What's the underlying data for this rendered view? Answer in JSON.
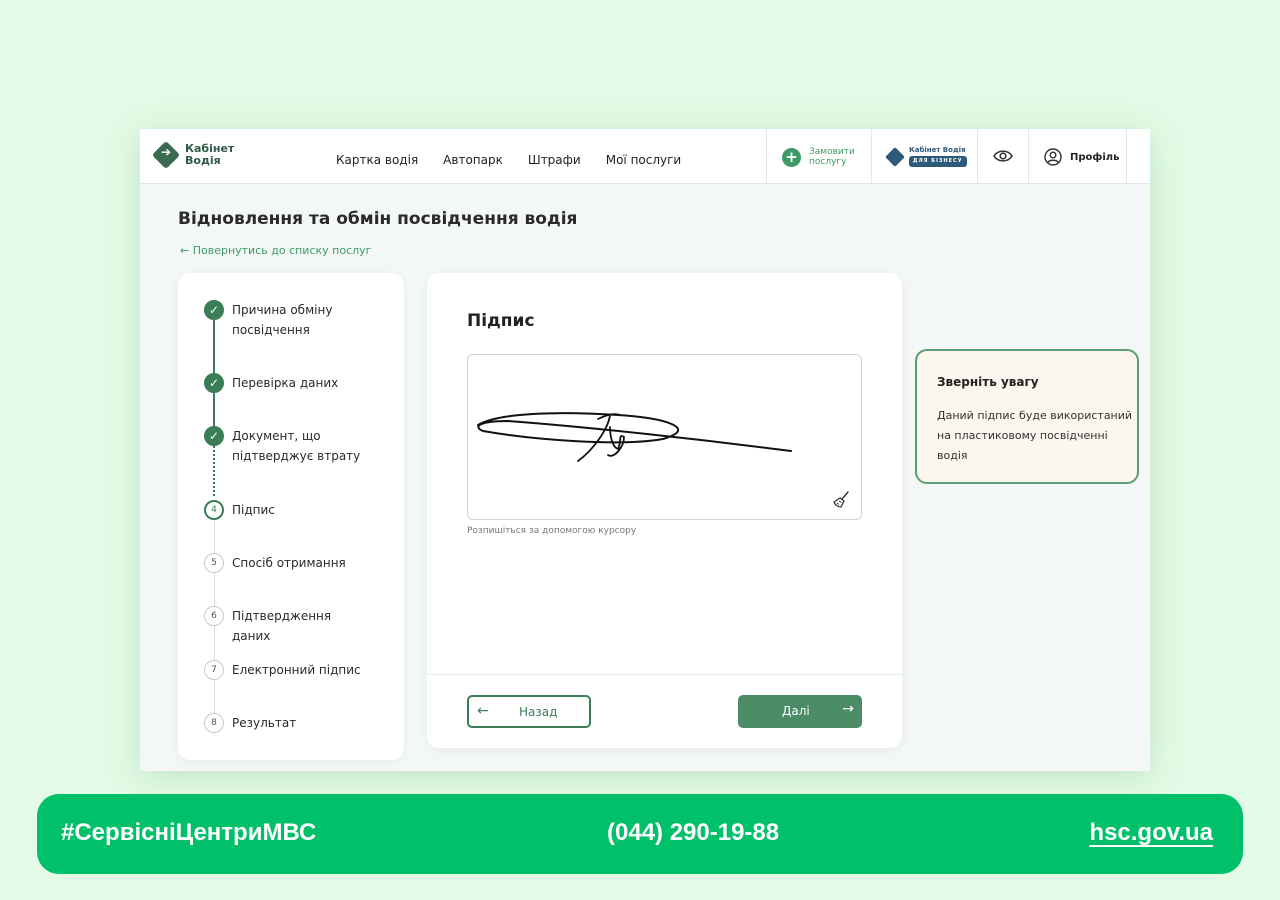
{
  "header": {
    "logo": {
      "line1": "Кабінет",
      "line2": "Водія"
    },
    "nav": [
      "Картка водія",
      "Автопарк",
      "Штрафи",
      "Мої послуги"
    ],
    "order_button": "Замовити послугу",
    "business": {
      "line1": "Кабінет Водія",
      "line2": "ДЛЯ БІЗНЕСУ"
    },
    "profile": "Профіль"
  },
  "page": {
    "title": "Відновлення та обмін посвідчення водія",
    "back_link": "← Повернутись до списку послуг"
  },
  "steps": [
    {
      "number": "1",
      "label": "Причина обміну посвідчення",
      "status": "done"
    },
    {
      "number": "2",
      "label": "Перевірка даних",
      "status": "done"
    },
    {
      "number": "3",
      "label": "Документ, що підтверджує втрату",
      "status": "done"
    },
    {
      "number": "4",
      "label": "Підпис",
      "status": "current"
    },
    {
      "number": "5",
      "label": "Спосіб отримання",
      "status": "pending"
    },
    {
      "number": "6",
      "label": "Підтвердження даних",
      "status": "pending"
    },
    {
      "number": "7",
      "label": "Електронний підпис",
      "status": "pending"
    },
    {
      "number": "8",
      "label": "Результат",
      "status": "pending"
    }
  ],
  "signature": {
    "title": "Підпис",
    "hint": "Розпишіться за допомогою курсору",
    "back_button": "Назад",
    "next_button": "Далі"
  },
  "notice": {
    "title": "Зверніть увагу",
    "text": "Даний підпис буде використаний на пластиковому посвідченні водія"
  },
  "banner": {
    "hashtag": "#СервісніЦентриМВС",
    "phone": "(044) 290-19-88",
    "site": "hsc.gov.ua"
  },
  "colors": {
    "background": "#e3fbe6",
    "accent": "#3a7d56",
    "banner": "#00c06a",
    "notice_bg": "#fbf6ee"
  }
}
